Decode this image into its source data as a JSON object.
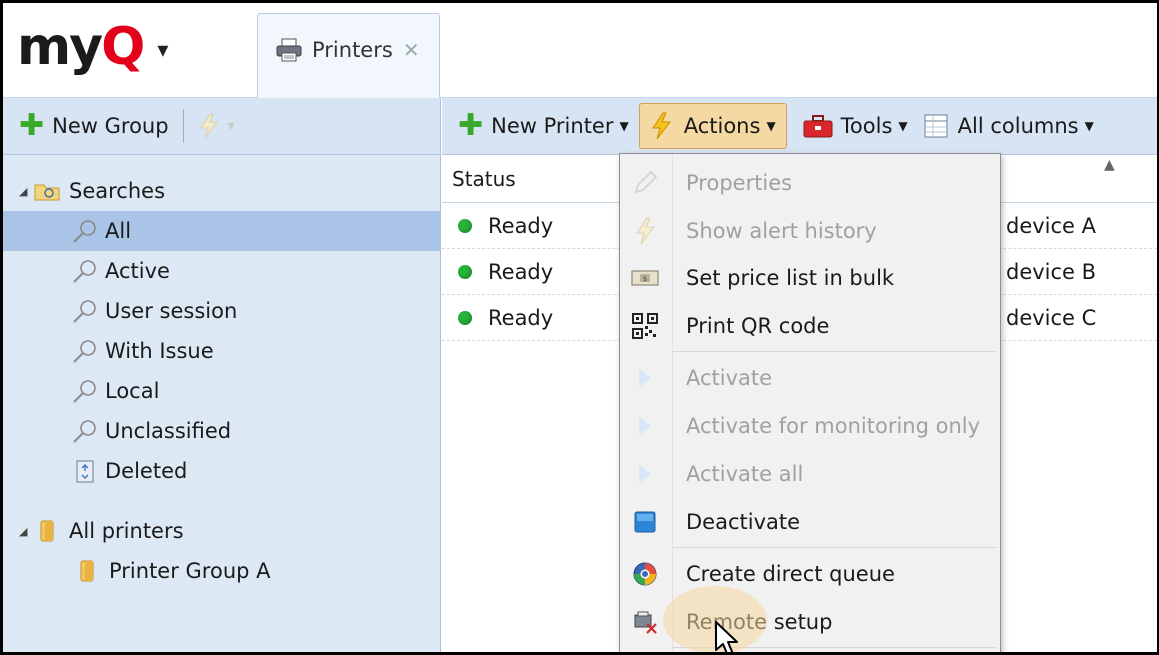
{
  "app": {
    "logo_text_a": "my",
    "logo_text_q": "Q",
    "logo_caret": "▾",
    "tab_label": "Printers",
    "tab_close": "✕"
  },
  "left_toolbar": {
    "new_group_label": "New Group",
    "disabled_action_caret": "▾"
  },
  "tree": {
    "searches_label": "Searches",
    "search_items": [
      "All",
      "Active",
      "User session",
      "With Issue",
      "Local",
      "Unclassified"
    ],
    "deleted_label": "Deleted",
    "all_printers_label": "All printers",
    "printer_group_label": "Printer Group A",
    "selected_index": 0
  },
  "right_toolbar": {
    "new_printer_label": "New Printer",
    "actions_label": "Actions",
    "tools_label": "Tools",
    "all_columns_label": "All columns"
  },
  "grid": {
    "status_header": "Status",
    "rows": [
      {
        "status": "Ready",
        "name": "device A"
      },
      {
        "status": "Ready",
        "name": "device B"
      },
      {
        "status": "Ready",
        "name": "device C"
      }
    ]
  },
  "actions_menu": {
    "items": [
      {
        "label": "Properties",
        "icon": "pencil-icon",
        "disabled": true
      },
      {
        "label": "Show alert history",
        "icon": "lightning-icon",
        "disabled": true
      },
      {
        "label": "Set price list in bulk",
        "icon": "price-list-icon",
        "disabled": false
      },
      {
        "label": "Print QR code",
        "icon": "qr-code-icon",
        "disabled": false
      },
      {
        "label": "Activate",
        "icon": "play-icon",
        "disabled": true
      },
      {
        "label": "Activate for monitoring only",
        "icon": "play-icon",
        "disabled": true
      },
      {
        "label": "Activate all",
        "icon": "play-icon",
        "disabled": true
      },
      {
        "label": "Deactivate",
        "icon": "stop-icon",
        "disabled": false
      },
      {
        "label": "Create direct queue",
        "icon": "globe-icon",
        "disabled": false
      },
      {
        "label": "Remote setup",
        "icon": "remote-setup-icon",
        "disabled": false
      }
    ]
  },
  "colors": {
    "accent_green": "#3aa829",
    "status_ready": "#27b23a",
    "logo_red": "#e2001a",
    "actions_highlight": "#f4d9a3",
    "selection": "#a9c4e6"
  }
}
